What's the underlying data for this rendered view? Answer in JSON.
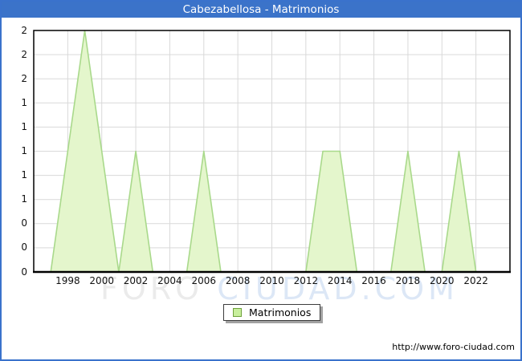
{
  "title": "Cabezabellosa - Matrimonios",
  "legend": {
    "label": "Matrimonios"
  },
  "watermark": {
    "part1": "FORO",
    "part2": "CIUDAD.COM"
  },
  "footer": {
    "url": "http://www.foro-ciudad.com"
  },
  "colors": {
    "titlebar_bg": "#3b73c9",
    "frame_border": "#3a72cc",
    "area_fill": "#e4f6cc",
    "area_stroke": "#a9d98b",
    "grid": "#d9d9d9",
    "axis": "#000000",
    "legend_swatch_fill": "#c8ef9d",
    "legend_swatch_border": "#6fa13c",
    "watermark_gray": "#ebebeb",
    "watermark_blue": "#dce7f6"
  },
  "chart_data": {
    "type": "area",
    "title": "Cabezabellosa - Matrimonios",
    "series_name": "Matrimonios",
    "categories": [
      1996,
      1997,
      1998,
      1999,
      2000,
      2001,
      2002,
      2003,
      2004,
      2005,
      2006,
      2007,
      2008,
      2009,
      2010,
      2011,
      2012,
      2013,
      2014,
      2015,
      2016,
      2017,
      2018,
      2019,
      2020,
      2021,
      2022,
      2023
    ],
    "values": [
      0,
      0,
      1,
      2,
      1,
      0,
      1,
      0,
      0,
      0,
      1,
      0,
      0,
      0,
      0,
      0,
      0,
      1,
      1,
      0,
      0,
      0,
      1,
      0,
      0,
      1,
      0,
      0
    ],
    "ylim": [
      0,
      2
    ],
    "xlim": [
      1996,
      2024
    ],
    "y_ticks_step": 0.2,
    "y_tick_labels_top_to_bottom": [
      "2",
      "2",
      "2",
      "1",
      "1",
      "1",
      "1",
      "1",
      "0",
      "0",
      "0"
    ],
    "x_tick_years": [
      1998,
      2000,
      2002,
      2004,
      2006,
      2008,
      2010,
      2012,
      2014,
      2016,
      2018,
      2020,
      2022
    ],
    "grid": true,
    "legend_position": "bottom-center"
  }
}
